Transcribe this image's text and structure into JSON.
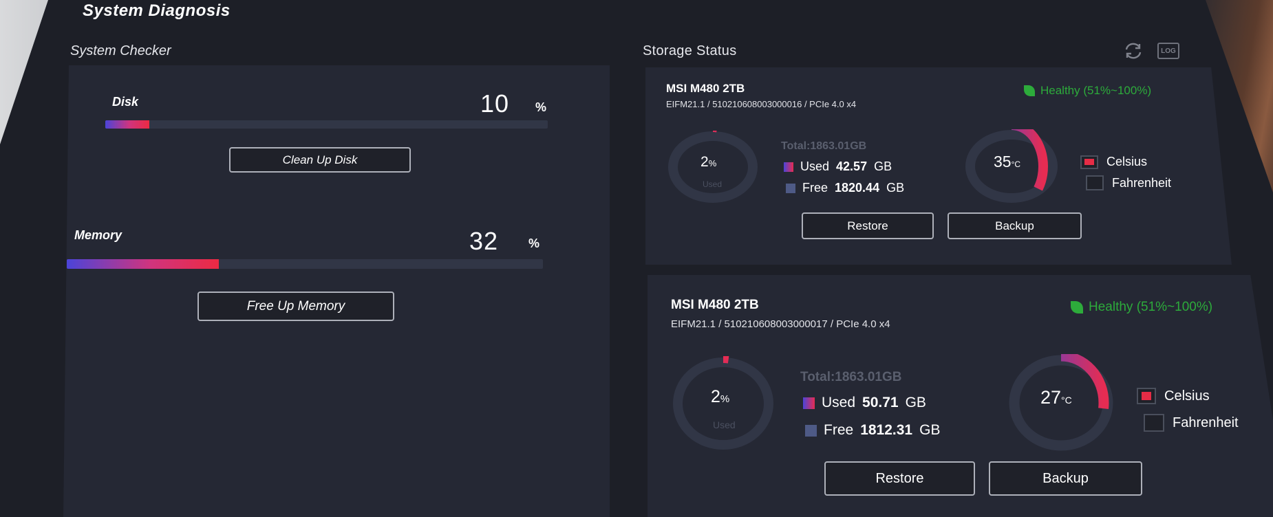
{
  "window": {
    "title": "System Diagnosis"
  },
  "checker": {
    "label": "System Checker",
    "disk": {
      "name": "Disk",
      "value": "10",
      "unit": "%",
      "percent": 10,
      "button": "Clean Up Disk"
    },
    "memory": {
      "name": "Memory",
      "value": "32",
      "unit": "%",
      "percent": 32,
      "button": "Free Up Memory"
    }
  },
  "storage": {
    "label": "Storage Status",
    "toolbar": {
      "refresh_icon": "refresh-icon",
      "log_label": "LOG"
    },
    "drives": [
      {
        "name": "MSI M480 2TB",
        "info": "EIFM21.1 / 510210608003000016 / PCIe 4.0 x4",
        "health": "Healthy (51%~100%)",
        "usage_percent": "2",
        "usage_unit": "%",
        "usage_caption": "Used",
        "usage_fraction": 0.02,
        "total": "Total:1863.01GB",
        "used_label": "Used",
        "used_value": "42.57",
        "used_unit": "GB",
        "free_label": "Free",
        "free_value": "1820.44",
        "free_unit": "GB",
        "temperature": "35",
        "temp_unit": "°C",
        "temp_fraction": 0.35,
        "celsius_label": "Celsius",
        "fahrenheit_label": "Fahrenheit",
        "restore_label": "Restore",
        "backup_label": "Backup"
      },
      {
        "name": "MSI M480 2TB",
        "info": "EIFM21.1 / 510210608003000017 / PCIe 4.0 x4",
        "health": "Healthy (51%~100%)",
        "usage_percent": "2",
        "usage_unit": "%",
        "usage_caption": "Used",
        "usage_fraction": 0.02,
        "total": "Total:1863.01GB",
        "used_label": "Used",
        "used_value": "50.71",
        "used_unit": "GB",
        "free_label": "Free",
        "free_value": "1812.31",
        "free_unit": "GB",
        "temperature": "27",
        "temp_unit": "°C",
        "temp_fraction": 0.27,
        "celsius_label": "Celsius",
        "fahrenheit_label": "Fahrenheit",
        "restore_label": "Restore",
        "backup_label": "Backup"
      }
    ]
  },
  "colors": {
    "accent_red": "#e62c46",
    "accent_blue": "#4b44d8",
    "healthy_green": "#2dab3b",
    "panel": "#252834",
    "background": "#1d1f27"
  }
}
